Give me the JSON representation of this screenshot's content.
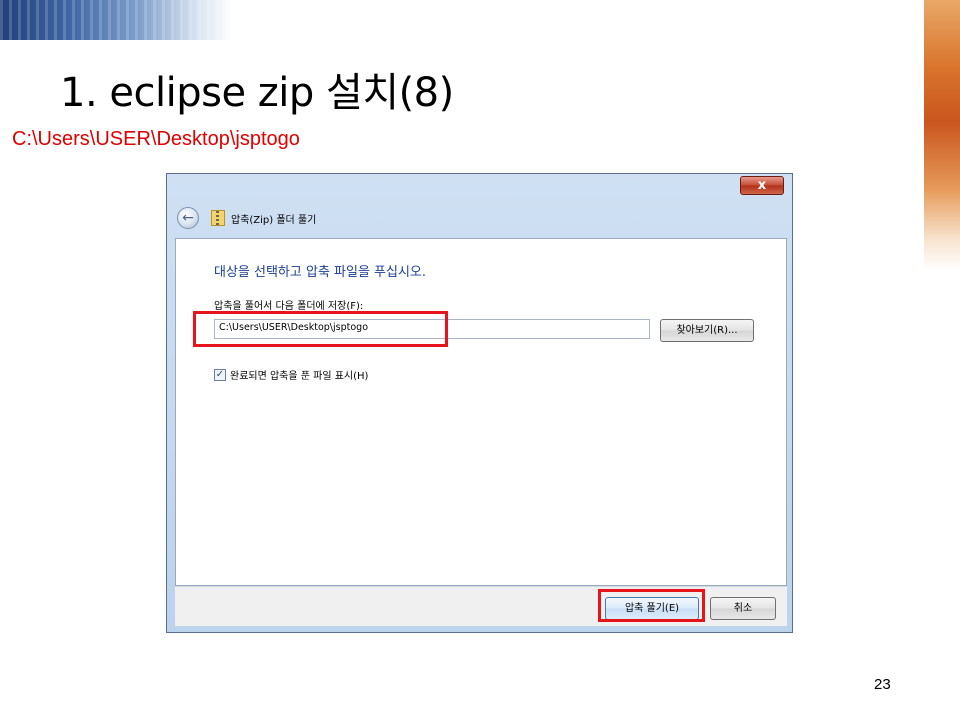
{
  "slide": {
    "title": "1. eclipse zip 설치(8)",
    "path_note": "C:\\Users\\USER\\Desktop\\jsptogo",
    "page_number": "23"
  },
  "dialog": {
    "close_label": "x",
    "nav_title": "압축(Zip) 폴더 풀기",
    "heading": "대상을 선택하고 압축 파일을 푸십시오.",
    "field_label": "압축을 풀어서 다음 폴더에 저장(F):",
    "path_value": "C:\\Users\\USER\\Desktop\\jsptogo",
    "browse_label": "찾아보기(R)...",
    "checkbox_label": "완료되면 압축을 푼 파일 표시(H)",
    "checkbox_checked": true,
    "extract_label": "압축 풀기(E)",
    "cancel_label": "취소"
  },
  "colors": {
    "highlight": "#e8141b",
    "path_note": "#e00000",
    "heading": "#1b3f95"
  },
  "icons": {
    "back": "back-arrow-icon",
    "zip": "zip-folder-icon",
    "close": "close-icon",
    "check": "checkmark-icon"
  }
}
